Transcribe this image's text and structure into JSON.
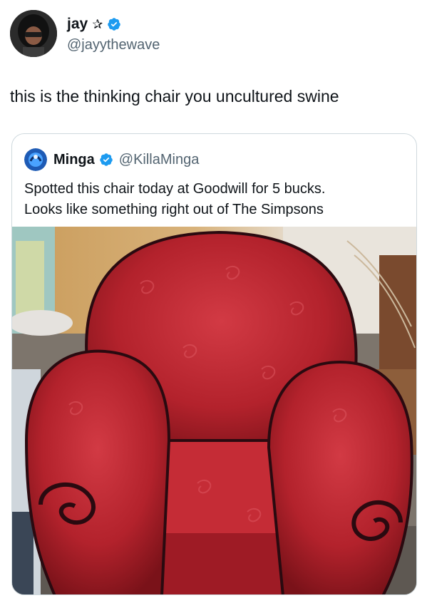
{
  "author": {
    "display_name": "jay",
    "name_emoji": "✰",
    "handle": "@jayythewave"
  },
  "tweet": {
    "text": "this is the thinking chair you uncultured swine"
  },
  "quoted": {
    "display_name": "Minga",
    "handle": "@KillaMinga",
    "text_line1": "Spotted this chair today at Goodwill for 5 bucks.",
    "text_line2": "Looks like something right out of The Simpsons",
    "image_icon": "red-armchair-photo"
  },
  "colors": {
    "verified": "#1d9bf0",
    "text": "#0f1419",
    "secondary": "#536471",
    "border": "#cfd9de",
    "chair": "#b3222c"
  }
}
